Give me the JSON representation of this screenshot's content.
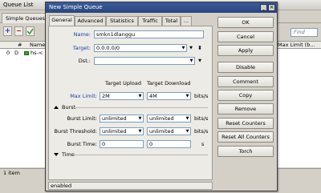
{
  "queue_list": {
    "title": "Queue List",
    "tab": "Simple Queues",
    "find_placeholder": "Find",
    "columns": {
      "flags": "#",
      "name": "Name",
      "max_limit": "Max Limit (b..."
    },
    "row": {
      "num": "0",
      "flag": "D",
      "name": "hs-<"
    },
    "status": "1 item"
  },
  "dialog": {
    "title": "New Simple Queue",
    "tabs": [
      "General",
      "Advanced",
      "Statistics",
      "Traffic",
      "Total",
      "..."
    ],
    "name": {
      "label": "Name:",
      "value": "smkn1dlanggu"
    },
    "target": {
      "label": "Target:",
      "value": "0.0.0.0/0"
    },
    "dst": {
      "label": "Dst.:",
      "value": ""
    },
    "col_upload": "Target Upload",
    "col_download": "Target Download",
    "max_limit": {
      "label": "Max Limit:",
      "upload": "2M",
      "download": "4M",
      "unit": "bits/s"
    },
    "burst_section": "Burst",
    "burst_limit": {
      "label": "Burst Limit:",
      "upload": "unlimited",
      "download": "unlimited",
      "unit": "bits/s"
    },
    "burst_threshold": {
      "label": "Burst Threshold:",
      "upload": "unlimited",
      "download": "unlimited",
      "unit": "bits/s"
    },
    "burst_time": {
      "label": "Burst Time:",
      "upload": "0",
      "download": "0",
      "unit": "s"
    },
    "time_section": "Time",
    "status": "enabled",
    "buttons": [
      "OK",
      "Cancel",
      "Apply",
      "Disable",
      "Comment",
      "Copy",
      "Remove",
      "Reset Counters",
      "Reset All Counters",
      "Torch"
    ]
  }
}
